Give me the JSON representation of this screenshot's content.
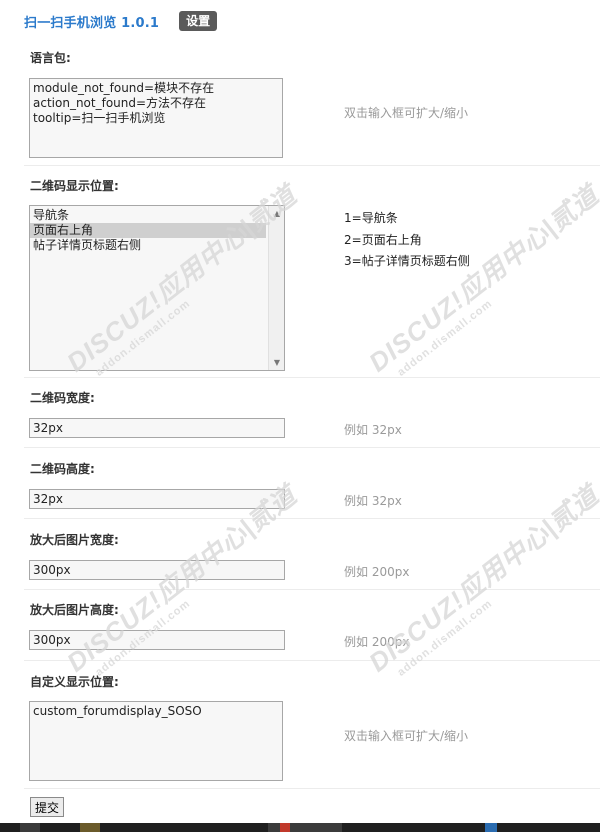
{
  "header": {
    "title": "扫一扫手机浏览 1.0.1",
    "badge": "设置"
  },
  "fields": {
    "lang": {
      "label": "语言包:",
      "lines": [
        "module_not_found=模块不存在",
        "action_not_found=方法不存在",
        "tooltip=扫一扫手机浏览"
      ],
      "hint": "双击输入框可扩大/缩小"
    },
    "position": {
      "label": "二维码显示位置:",
      "options": [
        "导航条",
        "页面右上角",
        "帖子详情页标题右侧"
      ],
      "selected": "页面右上角",
      "legend": [
        "1=导航条",
        "2=页面右上角",
        "3=帖子详情页标题右侧"
      ]
    },
    "qr_width": {
      "label": "二维码宽度:",
      "value": "32px",
      "hint": "例如 32px"
    },
    "qr_height": {
      "label": "二维码高度:",
      "value": "32px",
      "hint": "例如 32px"
    },
    "zoom_width": {
      "label": "放大后图片宽度:",
      "value": "300px",
      "hint": "例如 200px"
    },
    "zoom_height": {
      "label": "放大后图片高度:",
      "value": "300px",
      "hint": "例如 200px"
    },
    "custom": {
      "label": "自定义显示位置:",
      "lines": [
        "custom_forumdisplay_SOSO"
      ],
      "hint": "双击输入框可扩大/缩小"
    }
  },
  "submit": {
    "label": "提交"
  },
  "watermark": {
    "brand": "DISCUZ!应用中心|贰道",
    "url": "addon.dismall.com"
  }
}
